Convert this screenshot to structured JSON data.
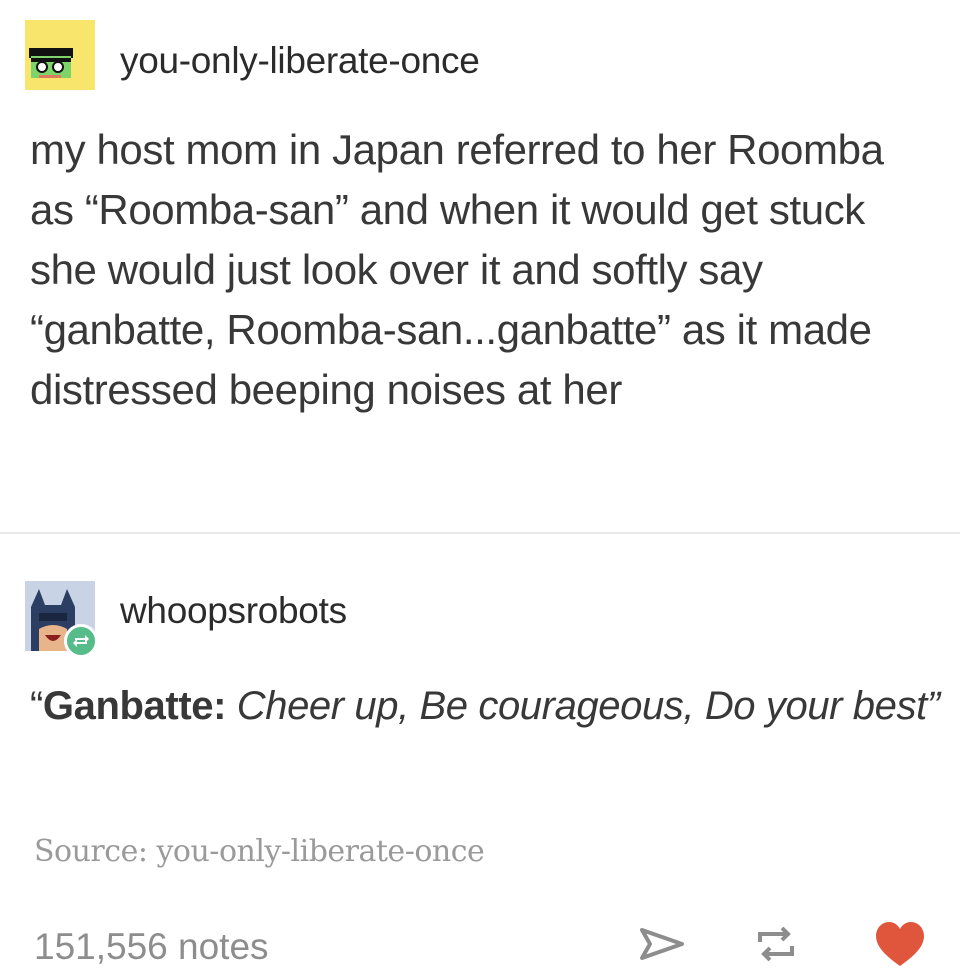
{
  "posts": [
    {
      "username": "you-only-liberate-once",
      "avatar_icon": "pixel-character-avatar",
      "body": "my host mom in Japan referred to her Roomba as “Roomba-san” and when it would get stuck she would just look over it and softly say “ganbatte, Roomba-san...ganbatte” as it made distressed beeping noises at her"
    },
    {
      "username": "whoopsrobots",
      "avatar_icon": "batman-avatar",
      "reblog_badge_icon": "reblog-icon",
      "quote": {
        "open": "“",
        "term": "Ganbatte:",
        "definition": "Cheer up, Be courageous, Do your best”"
      }
    }
  ],
  "footer": {
    "source": "Source: you-only-liberate-once",
    "notes": "151,556 notes",
    "actions": {
      "share_icon": "share-icon",
      "reblog_icon": "reblog-icon",
      "like_icon": "heart-icon"
    }
  },
  "colors": {
    "like_color": "#e0563d",
    "reblog_badge": "#56bc8a",
    "text": "#383838",
    "muted": "#8d8d8d"
  }
}
